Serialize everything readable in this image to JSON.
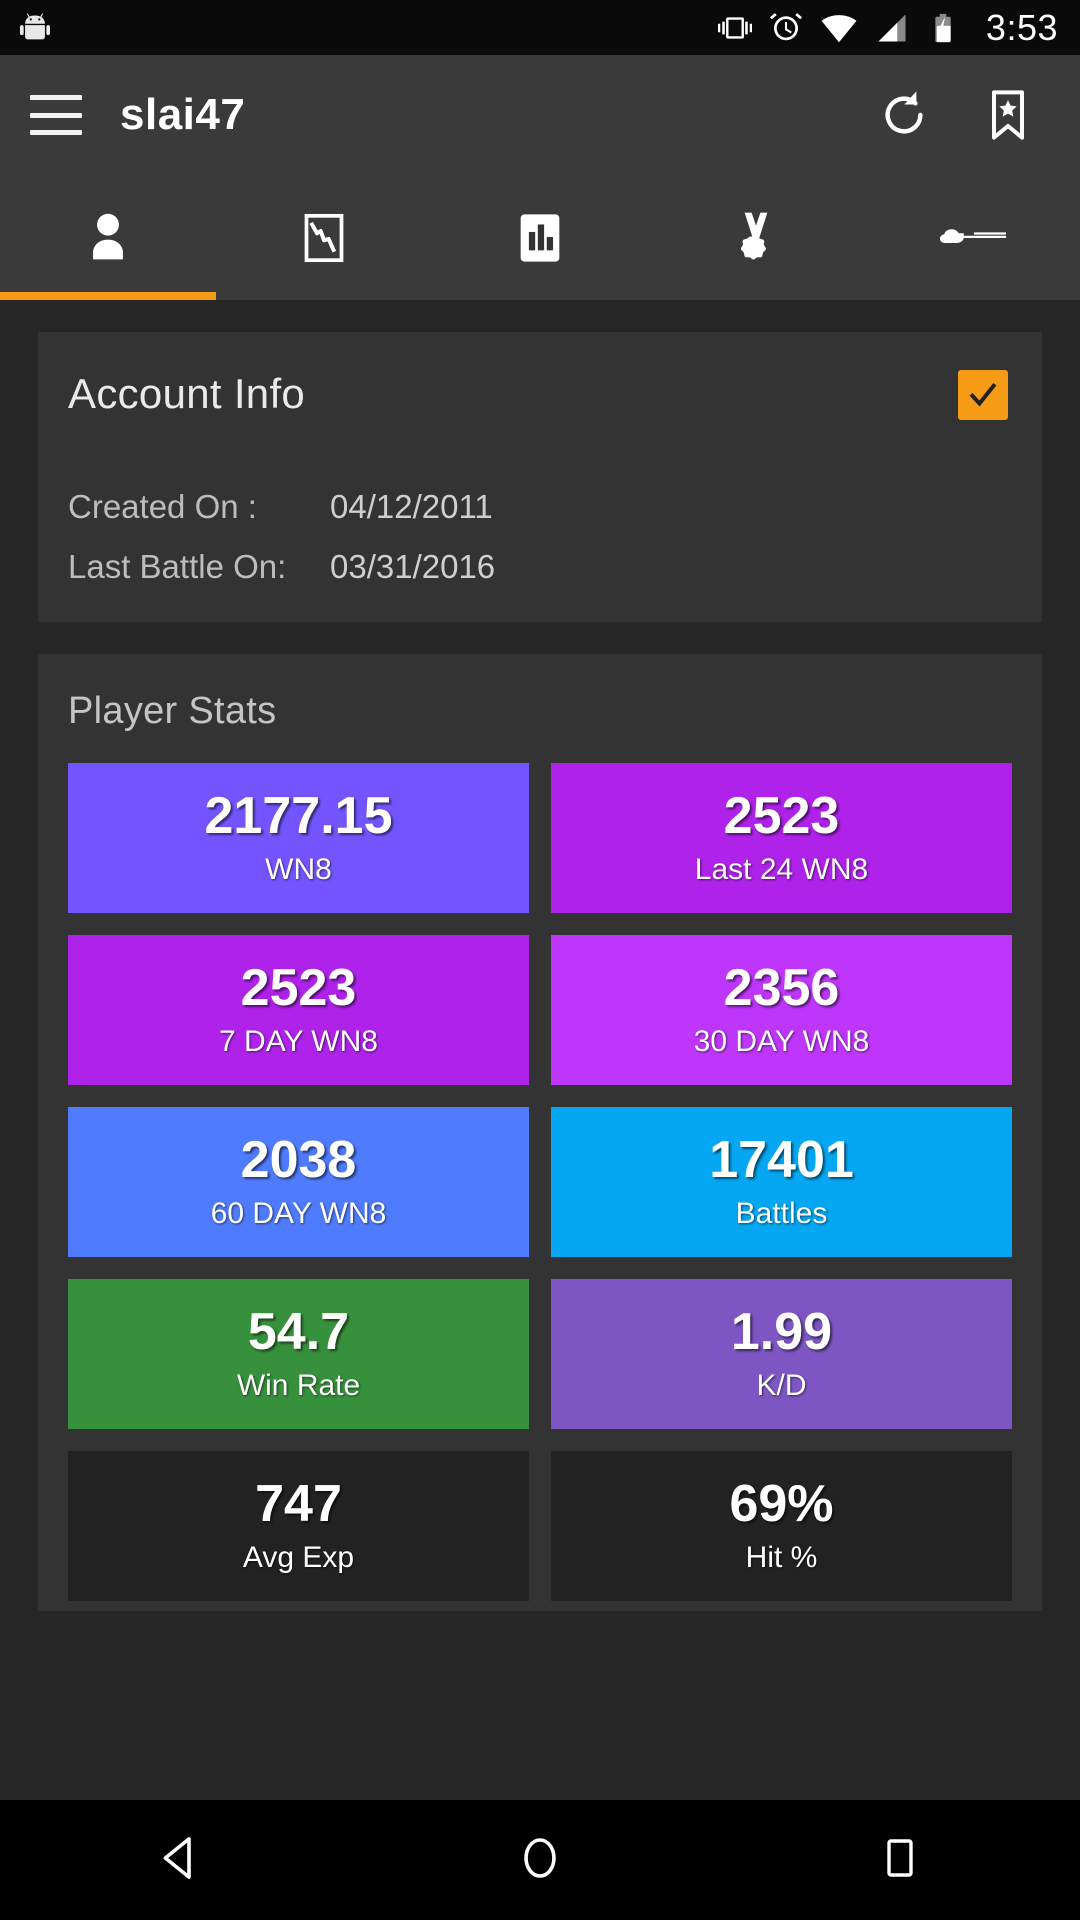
{
  "status_bar": {
    "time": "3:53",
    "icons": [
      "android-mascot-icon",
      "vibrate-icon",
      "alarm-icon",
      "wifi-icon",
      "cell-signal-icon",
      "battery-charging-icon"
    ]
  },
  "app_bar": {
    "menu_icon": "hamburger-menu-icon",
    "title": "slai47",
    "refresh_icon": "refresh-icon",
    "bookmark_icon": "bookmark-star-icon"
  },
  "tabs": {
    "active_index": 0,
    "accent_color": "#F59B16",
    "items": [
      {
        "icon": "person-icon",
        "name": "tab-profile"
      },
      {
        "icon": "line-chart-icon",
        "name": "tab-graph"
      },
      {
        "icon": "bar-chart-icon",
        "name": "tab-stats"
      },
      {
        "icon": "medal-icon",
        "name": "tab-achievements"
      },
      {
        "icon": "tank-icon",
        "name": "tab-tanks"
      }
    ]
  },
  "account_info": {
    "title": "Account Info",
    "checkbox_checked": true,
    "checkbox_color": "#F59B16",
    "rows": [
      {
        "label": "Created On :",
        "value": "04/12/2011"
      },
      {
        "label": "Last Battle On:",
        "value": "03/31/2016"
      }
    ]
  },
  "player_stats": {
    "title": "Player Stats",
    "tiles": [
      {
        "value": "2177.15",
        "label": "WN8",
        "color": "#7355FF"
      },
      {
        "value": "2523",
        "label": "Last 24 WN8",
        "color": "#AF22EA"
      },
      {
        "value": "2523",
        "label": "7 DAY WN8",
        "color": "#AF22EA"
      },
      {
        "value": "2356",
        "label": "30 DAY WN8",
        "color": "#BE36FB"
      },
      {
        "value": "2038",
        "label": "60 DAY WN8",
        "color": "#4F7BFF"
      },
      {
        "value": "17401",
        "label": "Battles",
        "color": "#05A6F2"
      },
      {
        "value": "54.7",
        "label": "Win Rate",
        "color": "#37903C"
      },
      {
        "value": "1.99",
        "label": "K/D",
        "color": "#7D56C4"
      },
      {
        "value": "747",
        "label": "Avg Exp",
        "color": "#222222"
      },
      {
        "value": "69%",
        "label": "Hit %",
        "color": "#222222"
      }
    ]
  },
  "nav_bar": {
    "back": "back-triangle-icon",
    "home": "home-circle-icon",
    "recents": "recents-square-icon"
  }
}
